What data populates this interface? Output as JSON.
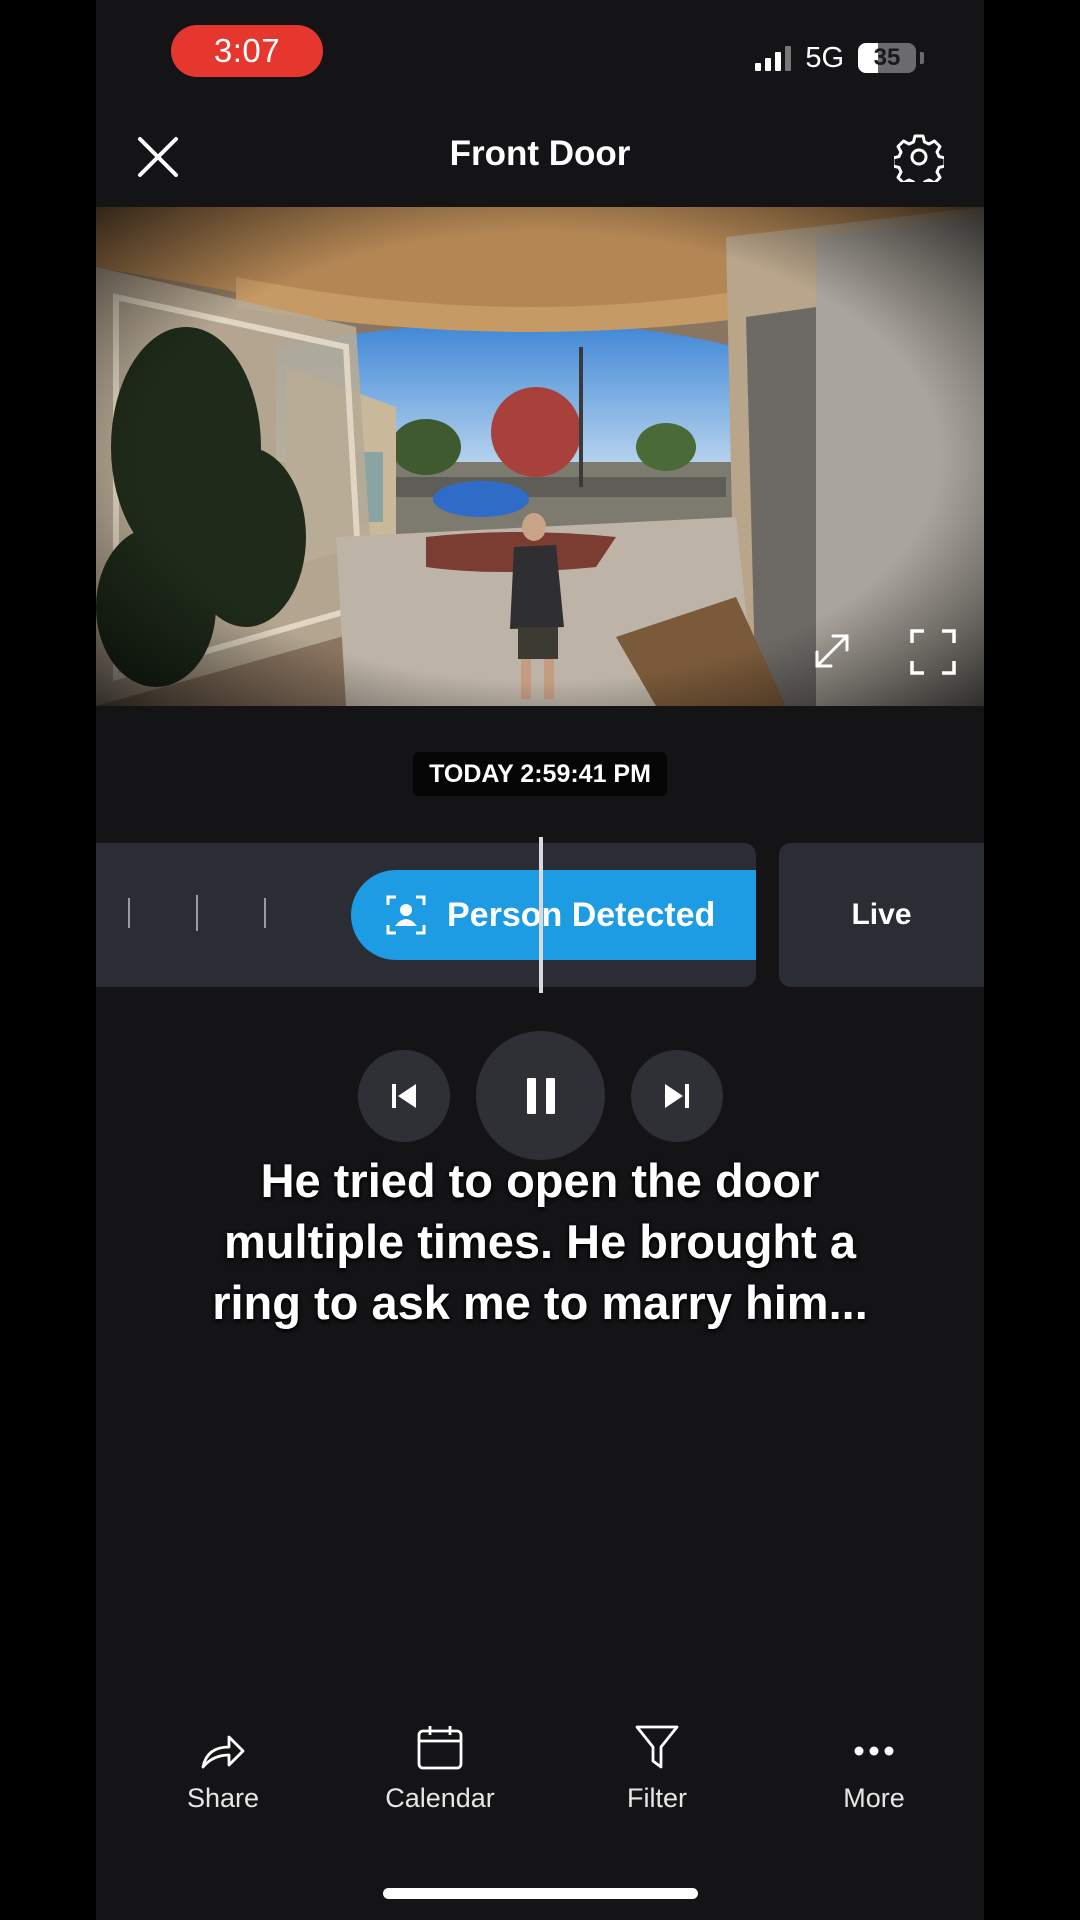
{
  "status_bar": {
    "time": "3:07",
    "network": "5G",
    "battery": "35"
  },
  "header": {
    "title": "Front Door"
  },
  "player": {
    "timestamp": "TODAY 2:59:41 PM"
  },
  "timeline": {
    "event_label": "Person Detected",
    "live_label": "Live"
  },
  "caption": {
    "text": "He tried to open the door multiple times. He brought a ring to ask me to marry him..."
  },
  "bottom_bar": {
    "items": [
      {
        "label": "Share",
        "icon": "share-icon"
      },
      {
        "label": "Calendar",
        "icon": "calendar-icon"
      },
      {
        "label": "Filter",
        "icon": "filter-icon"
      },
      {
        "label": "More",
        "icon": "more-icon"
      }
    ]
  },
  "colors": {
    "accent": "#1d9ce3",
    "recording_pill": "#e5372e",
    "background": "#141417"
  }
}
